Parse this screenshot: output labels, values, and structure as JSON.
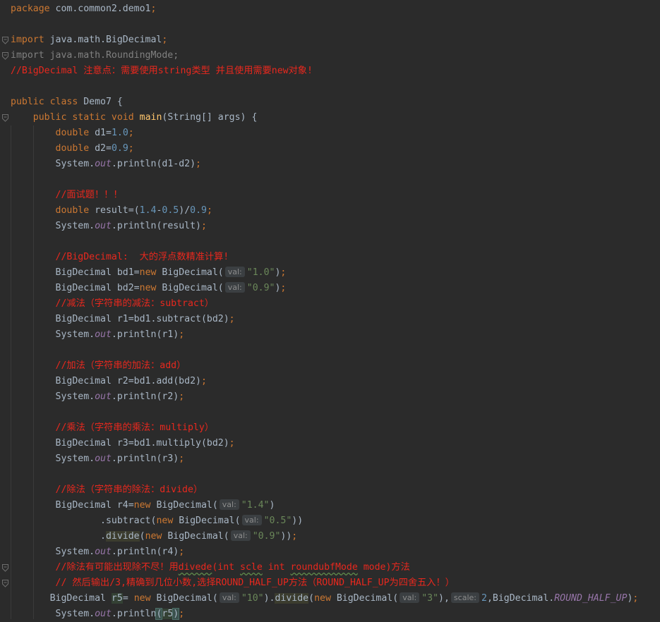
{
  "lines": [
    {
      "indent": 0,
      "tokens": [
        {
          "t": "package",
          "c": "kw"
        },
        {
          "t": " com.common2.demo1"
        },
        {
          "t": ";",
          "c": "kw"
        }
      ]
    },
    {
      "indent": 0,
      "tokens": []
    },
    {
      "indent": 0,
      "fold": true,
      "tokens": [
        {
          "t": "import",
          "c": "kw"
        },
        {
          "t": " java.math.BigDecimal"
        },
        {
          "t": ";",
          "c": "kw"
        }
      ]
    },
    {
      "indent": 0,
      "fold": true,
      "tokens": [
        {
          "t": "import java.math.RoundingMode;",
          "c": "gray"
        }
      ]
    },
    {
      "indent": 0,
      "tokens": [
        {
          "t": "//BigDecimal 注意点：需要使用string类型 并且使用需要new对象!",
          "c": "cmt"
        }
      ]
    },
    {
      "indent": 0,
      "tokens": []
    },
    {
      "indent": 0,
      "tokens": [
        {
          "t": "public class",
          "c": "kw"
        },
        {
          "t": " Demo7 {"
        }
      ]
    },
    {
      "indent": 0,
      "fold": true,
      "tokens": [
        {
          "t": "    "
        },
        {
          "t": "public static void",
          "c": "kw"
        },
        {
          "t": " "
        },
        {
          "t": "main",
          "c": "fn"
        },
        {
          "t": "(String[] args) {"
        }
      ]
    },
    {
      "indent": 0,
      "tokens": [
        {
          "t": "        "
        },
        {
          "t": "double",
          "c": "kw"
        },
        {
          "t": " d1="
        },
        {
          "t": "1.0",
          "c": "num"
        },
        {
          "t": ";",
          "c": "kw"
        }
      ]
    },
    {
      "indent": 0,
      "tokens": [
        {
          "t": "        "
        },
        {
          "t": "double",
          "c": "kw"
        },
        {
          "t": " d2="
        },
        {
          "t": "0.9",
          "c": "num"
        },
        {
          "t": ";",
          "c": "kw"
        }
      ]
    },
    {
      "indent": 0,
      "tokens": [
        {
          "t": "        System."
        },
        {
          "t": "out",
          "c": "field"
        },
        {
          "t": ".println(d1-d2)"
        },
        {
          "t": ";",
          "c": "kw"
        }
      ]
    },
    {
      "indent": 0,
      "tokens": []
    },
    {
      "indent": 0,
      "tokens": [
        {
          "t": "        "
        },
        {
          "t": "//面试题！！！",
          "c": "cmt"
        }
      ]
    },
    {
      "indent": 0,
      "tokens": [
        {
          "t": "        "
        },
        {
          "t": "double",
          "c": "kw"
        },
        {
          "t": " result=("
        },
        {
          "t": "1.4",
          "c": "num"
        },
        {
          "t": "-"
        },
        {
          "t": "0.5",
          "c": "num"
        },
        {
          "t": ")/"
        },
        {
          "t": "0.9",
          "c": "num"
        },
        {
          "t": ";",
          "c": "kw"
        }
      ]
    },
    {
      "indent": 0,
      "tokens": [
        {
          "t": "        System."
        },
        {
          "t": "out",
          "c": "field"
        },
        {
          "t": ".println(result)"
        },
        {
          "t": ";",
          "c": "kw"
        }
      ]
    },
    {
      "indent": 0,
      "tokens": []
    },
    {
      "indent": 0,
      "tokens": [
        {
          "t": "        "
        },
        {
          "t": "//BigDecimal:  大的浮点数精准计算!",
          "c": "cmt"
        }
      ]
    },
    {
      "indent": 0,
      "tokens": [
        {
          "t": "        BigDecimal bd1="
        },
        {
          "t": "new",
          "c": "kw"
        },
        {
          "t": " BigDecimal("
        },
        {
          "t": "val:",
          "c": "hint"
        },
        {
          "t": "\"1.0\"",
          "c": "str"
        },
        {
          "t": ")"
        },
        {
          "t": ";",
          "c": "kw"
        }
      ]
    },
    {
      "indent": 0,
      "tokens": [
        {
          "t": "        BigDecimal bd2="
        },
        {
          "t": "new",
          "c": "kw"
        },
        {
          "t": " BigDecimal("
        },
        {
          "t": "val:",
          "c": "hint"
        },
        {
          "t": "\"0.9\"",
          "c": "str"
        },
        {
          "t": ")"
        },
        {
          "t": ";",
          "c": "kw"
        }
      ]
    },
    {
      "indent": 0,
      "tokens": [
        {
          "t": "        "
        },
        {
          "t": "//减法（字符串的减法：subtract）",
          "c": "cmt"
        }
      ]
    },
    {
      "indent": 0,
      "tokens": [
        {
          "t": "        BigDecimal r1=bd1.subtract(bd2)"
        },
        {
          "t": ";",
          "c": "kw"
        }
      ]
    },
    {
      "indent": 0,
      "tokens": [
        {
          "t": "        System."
        },
        {
          "t": "out",
          "c": "field"
        },
        {
          "t": ".println(r1)"
        },
        {
          "t": ";",
          "c": "kw"
        }
      ]
    },
    {
      "indent": 0,
      "tokens": []
    },
    {
      "indent": 0,
      "tokens": [
        {
          "t": "        "
        },
        {
          "t": "//加法（字符串的加法：add）",
          "c": "cmt"
        }
      ]
    },
    {
      "indent": 0,
      "tokens": [
        {
          "t": "        BigDecimal r2=bd1.add(bd2)"
        },
        {
          "t": ";",
          "c": "kw"
        }
      ]
    },
    {
      "indent": 0,
      "tokens": [
        {
          "t": "        System."
        },
        {
          "t": "out",
          "c": "field"
        },
        {
          "t": ".println(r2)"
        },
        {
          "t": ";",
          "c": "kw"
        }
      ]
    },
    {
      "indent": 0,
      "tokens": []
    },
    {
      "indent": 0,
      "tokens": [
        {
          "t": "        "
        },
        {
          "t": "//乘法（字符串的乘法：multiply）",
          "c": "cmt"
        }
      ]
    },
    {
      "indent": 0,
      "tokens": [
        {
          "t": "        BigDecimal r3=bd1.multiply(bd2)"
        },
        {
          "t": ";",
          "c": "kw"
        }
      ]
    },
    {
      "indent": 0,
      "tokens": [
        {
          "t": "        System."
        },
        {
          "t": "out",
          "c": "field"
        },
        {
          "t": ".println(r3)"
        },
        {
          "t": ";",
          "c": "kw"
        }
      ]
    },
    {
      "indent": 0,
      "tokens": []
    },
    {
      "indent": 0,
      "tokens": [
        {
          "t": "        "
        },
        {
          "t": "//除法（字符串的除法：divide）",
          "c": "cmt"
        }
      ]
    },
    {
      "indent": 0,
      "tokens": [
        {
          "t": "        BigDecimal r4="
        },
        {
          "t": "new",
          "c": "kw"
        },
        {
          "t": " BigDecimal("
        },
        {
          "t": "val:",
          "c": "hint"
        },
        {
          "t": "\"1.4\"",
          "c": "str"
        },
        {
          "t": ")"
        }
      ]
    },
    {
      "indent": 0,
      "tokens": [
        {
          "t": "                .subtract("
        },
        {
          "t": "new",
          "c": "kw"
        },
        {
          "t": " BigDecimal("
        },
        {
          "t": "val:",
          "c": "hint"
        },
        {
          "t": "\"0.5\"",
          "c": "str"
        },
        {
          "t": "))"
        }
      ]
    },
    {
      "indent": 0,
      "tokens": [
        {
          "t": "                ."
        },
        {
          "t": "divide",
          "c": "hl"
        },
        {
          "t": "("
        },
        {
          "t": "new",
          "c": "kw"
        },
        {
          "t": " BigDecimal("
        },
        {
          "t": "val:",
          "c": "hint"
        },
        {
          "t": "\"0.9\"",
          "c": "str"
        },
        {
          "t": "))"
        },
        {
          "t": ";",
          "c": "kw"
        }
      ]
    },
    {
      "indent": 0,
      "tokens": [
        {
          "t": "        System."
        },
        {
          "t": "out",
          "c": "field"
        },
        {
          "t": ".println(r4)"
        },
        {
          "t": ";",
          "c": "kw"
        }
      ]
    },
    {
      "indent": 0,
      "fold": true,
      "tokens": [
        {
          "t": "        "
        },
        {
          "t": "//除法有可能出现除不尽！用",
          "c": "cmt"
        },
        {
          "t": "divede",
          "c": "cmt squig"
        },
        {
          "t": "(int ",
          "c": "cmt"
        },
        {
          "t": "scle",
          "c": "cmt squig"
        },
        {
          "t": " int ",
          "c": "cmt"
        },
        {
          "t": "roundubfMode",
          "c": "cmt squig"
        },
        {
          "t": " mode)方法",
          "c": "cmt"
        }
      ]
    },
    {
      "indent": 0,
      "fold": true,
      "tokens": [
        {
          "t": "        "
        },
        {
          "t": "// 然后输出/3,精确到几位小数,选择ROUND_HALF_UP方法（ROUND_HALF_UP为四舍五入！）",
          "c": "cmt"
        }
      ]
    },
    {
      "indent": 0,
      "tokens": [
        {
          "t": "       BigDecimal "
        },
        {
          "t": "r5",
          "c": "hlfn"
        },
        {
          "t": "= "
        },
        {
          "t": "new",
          "c": "kw"
        },
        {
          "t": " BigDecimal("
        },
        {
          "t": "val:",
          "c": "hint"
        },
        {
          "t": "\"10\"",
          "c": "str"
        },
        {
          "t": ")."
        },
        {
          "t": "divide",
          "c": "hl"
        },
        {
          "t": "("
        },
        {
          "t": "new",
          "c": "kw"
        },
        {
          "t": " BigDecimal("
        },
        {
          "t": "val:",
          "c": "hint"
        },
        {
          "t": "\"3\"",
          "c": "str"
        },
        {
          "t": "),"
        },
        {
          "t": "scale:",
          "c": "hint"
        },
        {
          "t": "2",
          "c": "num"
        },
        {
          "t": ",BigDecimal."
        },
        {
          "t": "ROUND_HALF_UP",
          "c": "field"
        },
        {
          "t": ")"
        },
        {
          "t": ";",
          "c": "kw"
        }
      ]
    },
    {
      "indent": 0,
      "tokens": [
        {
          "t": "        System."
        },
        {
          "t": "out",
          "c": "field"
        },
        {
          "t": ".println"
        },
        {
          "t": "(",
          "c": "bracket"
        },
        {
          "t": "r5",
          "c": "hlfn"
        },
        {
          "t": ")",
          "c": "bracket"
        },
        {
          "t": ";",
          "c": "kw"
        }
      ]
    }
  ]
}
